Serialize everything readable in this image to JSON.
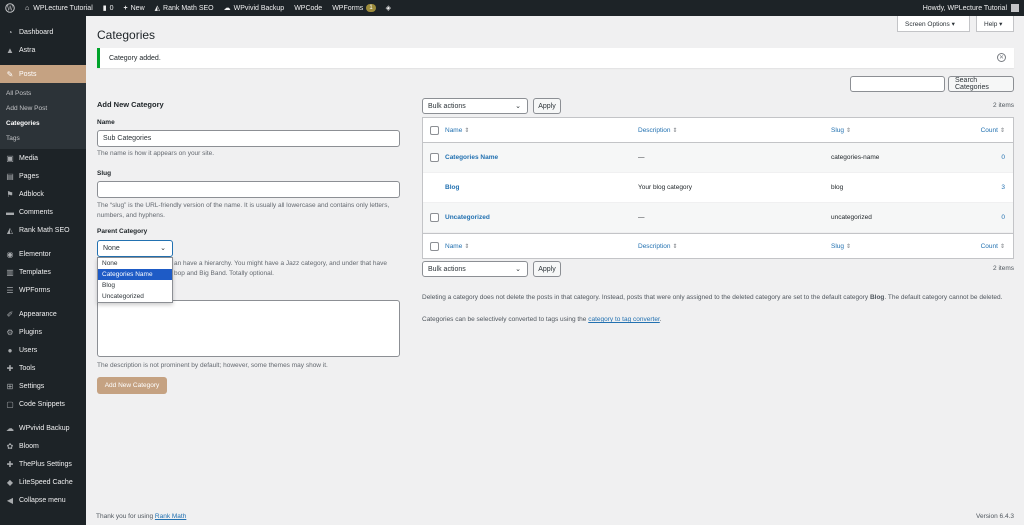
{
  "adminbar": {
    "site_name": "WPLecture Tutorial",
    "comments_count": "0",
    "new_label": "New",
    "rankmath_label": "Rank Math SEO",
    "wpvivid_label": "WPvivid Backup",
    "wpcode_label": "WPCode",
    "wpforms_label": "WPForms",
    "wpforms_badge": "1",
    "howdy": "Howdy, WPLecture Tutorial"
  },
  "sidebar": {
    "items": [
      {
        "label": "Dashboard",
        "icon": "dashboard-icon"
      },
      {
        "label": "Astra",
        "icon": "astra-icon"
      },
      {
        "label": "Posts",
        "icon": "pin-icon"
      },
      {
        "label": "Media",
        "icon": "media-icon"
      },
      {
        "label": "Pages",
        "icon": "pages-icon"
      },
      {
        "label": "Adblock",
        "icon": "adblock-icon"
      },
      {
        "label": "Comments",
        "icon": "comments-icon"
      },
      {
        "label": "Rank Math SEO",
        "icon": "rankmath-icon"
      },
      {
        "label": "Elementor",
        "icon": "elementor-icon"
      },
      {
        "label": "Templates",
        "icon": "templates-icon"
      },
      {
        "label": "WPForms",
        "icon": "wpforms-icon"
      },
      {
        "label": "Appearance",
        "icon": "appearance-icon"
      },
      {
        "label": "Plugins",
        "icon": "plugins-icon"
      },
      {
        "label": "Users",
        "icon": "users-icon"
      },
      {
        "label": "Tools",
        "icon": "tools-icon"
      },
      {
        "label": "Settings",
        "icon": "settings-icon"
      },
      {
        "label": "Code Snippets",
        "icon": "code-icon"
      },
      {
        "label": "WPvivid Backup",
        "icon": "backup-icon"
      },
      {
        "label": "Bloom",
        "icon": "bloom-icon"
      },
      {
        "label": "ThePlus Settings",
        "icon": "theplus-icon"
      },
      {
        "label": "LiteSpeed Cache",
        "icon": "litespeed-icon"
      },
      {
        "label": "Collapse menu",
        "icon": "collapse-icon"
      }
    ],
    "posts_submenu": [
      "All Posts",
      "Add New Post",
      "Categories",
      "Tags"
    ]
  },
  "header": {
    "screen_options": "Screen Options ▾",
    "help": "Help ▾",
    "title": "Categories"
  },
  "notice": {
    "text": "Category added."
  },
  "search": {
    "button": "Search Categories",
    "value": ""
  },
  "form": {
    "heading": "Add New Category",
    "name_label": "Name",
    "name_value": "Sub Categories",
    "name_help": "The name is how it appears on your site.",
    "slug_label": "Slug",
    "slug_value": "",
    "slug_help": "The “slug” is the URL-friendly version of the name. It is usually all lowercase and contains only letters, numbers, and hyphens.",
    "parent_label": "Parent Category",
    "parent_value": "None",
    "parent_options": [
      "None",
      "Categories Name",
      "Blog",
      "Uncategorized"
    ],
    "parent_help_partial": "an have a hierarchy. You might have a Jazz category, and under that have",
    "parent_help_partial2": "bop and Big Band. Totally optional.",
    "description_help": "The description is not prominent by default; however, some themes may show it.",
    "submit": "Add New Category"
  },
  "table": {
    "bulk_actions": "Bulk actions",
    "apply": "Apply",
    "items_count": "2 items",
    "columns": {
      "name": "Name",
      "description": "Description",
      "slug": "Slug",
      "count": "Count"
    },
    "rows": [
      {
        "name": "Categories Name",
        "description": "—",
        "slug": "categories-name",
        "count": "0"
      },
      {
        "name": "Blog",
        "description": "Your blog category",
        "slug": "blog",
        "count": "3"
      },
      {
        "name": "Uncategorized",
        "description": "—",
        "slug": "uncategorized",
        "count": "0"
      }
    ]
  },
  "notes": {
    "delete_note_1": "Deleting a category does not delete the posts in that category. Instead, posts that were only assigned to the deleted category are set to the default category ",
    "delete_note_bold": "Blog",
    "delete_note_2": ". The default category cannot be deleted.",
    "convert_note": "Categories can be selectively converted to tags using the ",
    "convert_link": "category to tag converter",
    "convert_end": "."
  },
  "footer": {
    "thanks": "Thank you for using ",
    "thanks_link": "Rank Math",
    "version": "Version 6.4.3"
  }
}
